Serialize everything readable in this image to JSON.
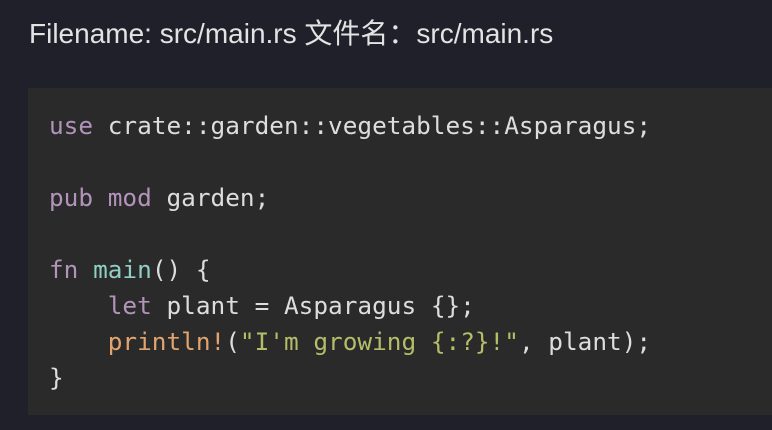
{
  "header": {
    "filename_label": "Filename: src/main.rs 文件名：src/main.rs"
  },
  "code": {
    "language": "rust",
    "lines": [
      {
        "segments": [
          {
            "text": "use",
            "kind": "keyword"
          },
          {
            "text": " crate::garden::vegetables::Asparagus;",
            "kind": "plain"
          }
        ]
      },
      {
        "segments": []
      },
      {
        "segments": [
          {
            "text": "pub",
            "kind": "keyword"
          },
          {
            "text": " ",
            "kind": "plain"
          },
          {
            "text": "mod",
            "kind": "keyword"
          },
          {
            "text": " garden;",
            "kind": "plain"
          }
        ]
      },
      {
        "segments": []
      },
      {
        "segments": [
          {
            "text": "fn",
            "kind": "keyword"
          },
          {
            "text": " ",
            "kind": "plain"
          },
          {
            "text": "main",
            "kind": "function"
          },
          {
            "text": "() {",
            "kind": "plain"
          }
        ]
      },
      {
        "segments": [
          {
            "text": "    ",
            "kind": "plain"
          },
          {
            "text": "let",
            "kind": "keyword"
          },
          {
            "text": " plant = Asparagus {};",
            "kind": "plain"
          }
        ]
      },
      {
        "segments": [
          {
            "text": "    ",
            "kind": "plain"
          },
          {
            "text": "println!",
            "kind": "macro"
          },
          {
            "text": "(",
            "kind": "plain"
          },
          {
            "text": "\"I'm growing {:?}!\"",
            "kind": "string"
          },
          {
            "text": ", plant);",
            "kind": "plain"
          }
        ]
      },
      {
        "segments": [
          {
            "text": "}",
            "kind": "plain"
          }
        ]
      }
    ]
  },
  "colors": {
    "page_background": "#1f2029",
    "code_background": "#2a2a2a",
    "keyword": "#b294bb",
    "function": "#8fcfc4",
    "macro": "#e2a46f",
    "string": "#b5bd68",
    "plain": "#dddddd"
  }
}
